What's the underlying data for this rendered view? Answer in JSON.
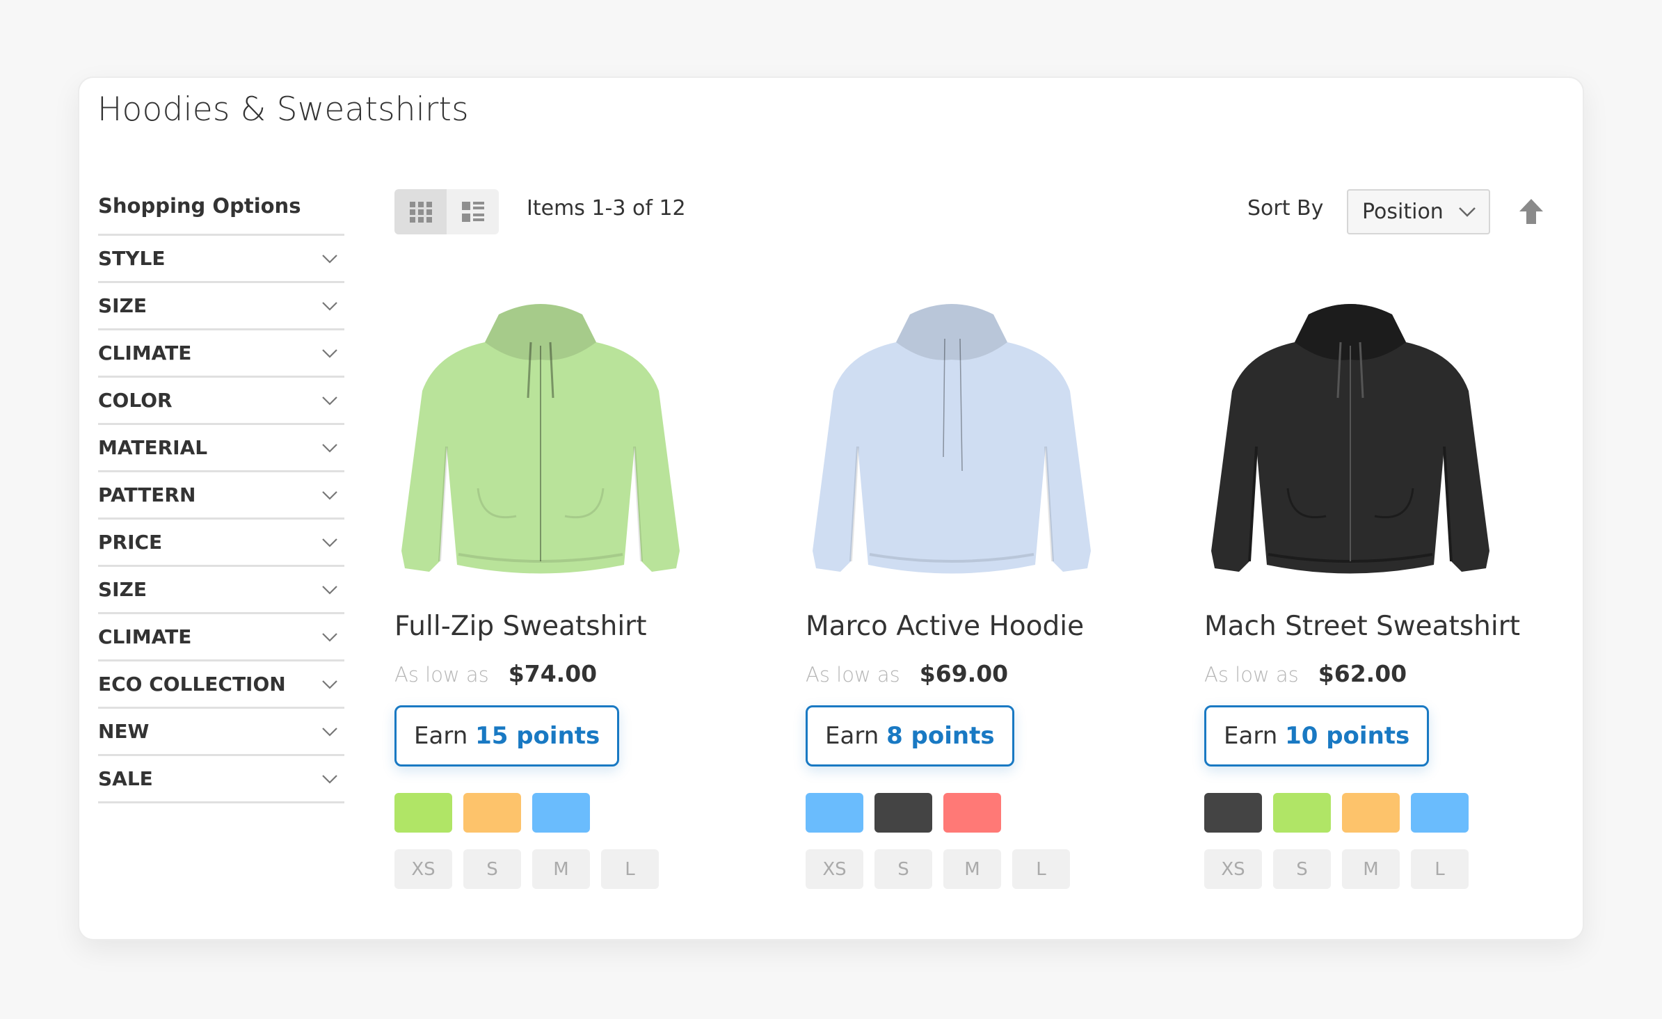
{
  "page": {
    "title": "Hoodies & Sweatshirts"
  },
  "sidebar": {
    "title": "Shopping Options",
    "filters": [
      {
        "label": "STYLE",
        "icon": "chevron-down-icon"
      },
      {
        "label": "SIZE",
        "icon": "chevron-down-icon"
      },
      {
        "label": "CLIMATE",
        "icon": "chevron-down-icon"
      },
      {
        "label": "COLOR",
        "icon": "chevron-down-icon"
      },
      {
        "label": "MATERIAL",
        "icon": "chevron-down-icon"
      },
      {
        "label": "PATTERN",
        "icon": "chevron-down-icon"
      },
      {
        "label": "PRICE",
        "icon": "chevron-down-icon"
      },
      {
        "label": "SIZE",
        "icon": "chevron-down-icon"
      },
      {
        "label": "CLIMATE",
        "icon": "chevron-down-icon"
      },
      {
        "label": "ECO COLLECTION",
        "icon": "chevron-down-icon"
      },
      {
        "label": "NEW",
        "icon": "chevron-down-icon"
      },
      {
        "label": "SALE",
        "icon": "chevron-down-icon"
      }
    ]
  },
  "toolbar": {
    "view_modes": [
      {
        "name": "grid",
        "icon": "grid-view-icon",
        "active": true
      },
      {
        "name": "list",
        "icon": "list-view-icon",
        "active": false
      }
    ],
    "items_count": "Items 1-3 of 12",
    "sort_label": "Sort By",
    "sort_selected": "Position",
    "sort_direction_icon": "arrow-up-icon"
  },
  "colors": {
    "accent": "#1979c3",
    "swatch_green": "#b0e566",
    "swatch_orange": "#fdc36b",
    "swatch_blue": "#6abcfd",
    "swatch_black": "#444444",
    "swatch_red": "#ff7976"
  },
  "products": [
    {
      "name": "Full-Zip Sweatshirt",
      "price_prefix": "As low as",
      "price": "$74.00",
      "earn_prefix": "Earn",
      "earn_points": "15 points",
      "image_color": "#b9e39a",
      "image_type": "zip-hoodie",
      "swatches": [
        "#b0e566",
        "#fdc36b",
        "#6abcfd"
      ],
      "sizes": [
        "XS",
        "S",
        "M",
        "L"
      ]
    },
    {
      "name": "Marco Active Hoodie",
      "price_prefix": "As low as",
      "price": "$69.00",
      "earn_prefix": "Earn",
      "earn_points": "8 points",
      "image_color": "#cfddf2",
      "image_type": "pullover-hoodie",
      "swatches": [
        "#6abcfd",
        "#444444",
        "#ff7976"
      ],
      "sizes": [
        "XS",
        "S",
        "M",
        "L"
      ]
    },
    {
      "name": "Mach Street Sweatshirt",
      "price_prefix": "As low as",
      "price": "$62.00",
      "earn_prefix": "Earn",
      "earn_points": "10 points",
      "image_color": "#2b2b2b",
      "image_type": "zip-hoodie",
      "swatches": [
        "#444444",
        "#b0e566",
        "#fdc36b",
        "#6abcfd"
      ],
      "sizes": [
        "XS",
        "S",
        "M",
        "L"
      ]
    }
  ]
}
